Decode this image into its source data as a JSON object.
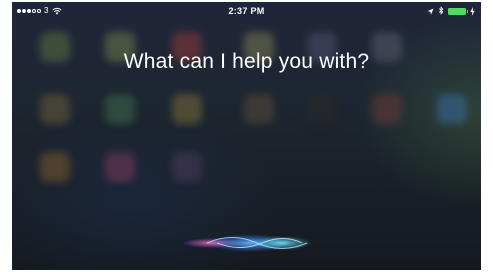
{
  "status_bar": {
    "carrier": "3",
    "time": "2:37 PM",
    "signal_icon": "signal-dots-icon",
    "wifi_icon": "wifi-icon",
    "location_icon": "location-arrow-icon",
    "bluetooth_icon": "bluetooth-icon",
    "battery_icon": "battery-icon",
    "charging_icon": "charging-bolt-icon",
    "battery_color": "#4cd964"
  },
  "siri": {
    "prompt": "What can I help you with?",
    "waveform_icon": "siri-waveform-icon",
    "waveform_colors": [
      "#ffffff",
      "#2f7dff",
      "#b85cff",
      "#ff4f7a",
      "#33d0ff"
    ]
  },
  "background": {
    "style": "blurred-home-screen",
    "accent_colors": [
      "#20263a",
      "#1a2229",
      "#3c5a3c"
    ]
  }
}
